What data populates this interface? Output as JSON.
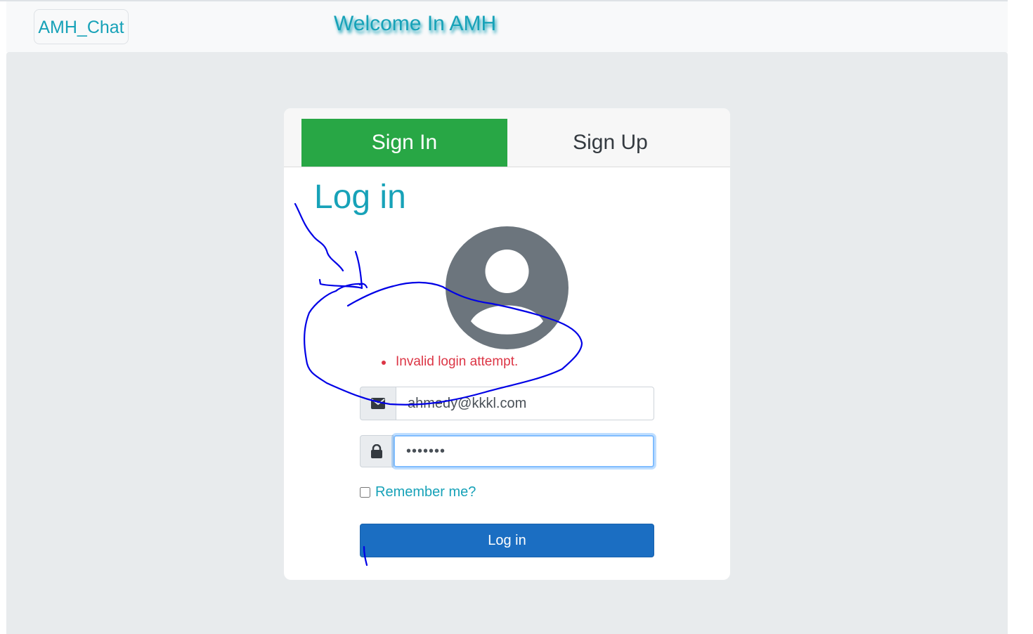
{
  "navbar": {
    "brand": "AMH_Chat",
    "welcome": "Welcome In AMH"
  },
  "tabs": {
    "sign_in": "Sign In",
    "sign_up": "Sign Up"
  },
  "login": {
    "title": "Log in",
    "errors": [
      "Invalid login attempt."
    ],
    "email_value": "ahmedy@kkkl.com",
    "password_value": "•••••••",
    "remember_label": "Remember me?",
    "remember_checked": false,
    "submit_label": "Log in"
  },
  "icons": {
    "avatar": "user-circle-icon",
    "email": "envelope-icon",
    "password": "lock-icon"
  },
  "colors": {
    "accent": "#17a2b8",
    "tab_active": "#28a745",
    "error": "#dc3545",
    "primary_button": "#1b6ec2",
    "avatar": "#6c757d",
    "scribble": "#0000e6"
  }
}
